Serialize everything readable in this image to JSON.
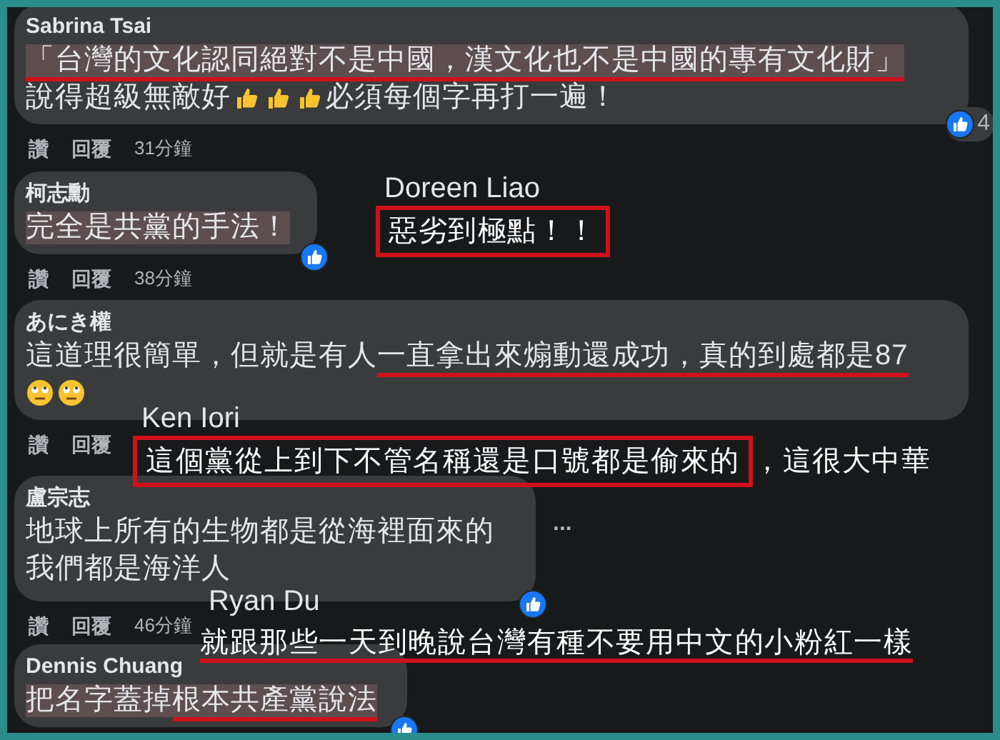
{
  "comments": [
    {
      "author": "Sabrina Tsai",
      "lines": [
        [
          {
            "kind": "text",
            "text": "「台灣的文化認同絕對不是中國，漢文化也不是中國的專有文化財」",
            "highlighted": true,
            "underlined": true
          }
        ],
        [
          {
            "kind": "text",
            "text": "說得超級無敵好",
            "highlighted": false,
            "underlined": false
          },
          {
            "kind": "thumbs"
          },
          {
            "kind": "thumbs"
          },
          {
            "kind": "thumbs"
          },
          {
            "kind": "text",
            "text": "必須每個字再打一遍！",
            "highlighted": false,
            "underlined": false
          }
        ]
      ],
      "has_reaction": true,
      "reaction_count": "4",
      "actions": [
        "讚",
        "回覆"
      ],
      "time": "31分鐘"
    },
    {
      "author": "柯志勳",
      "lines": [
        [
          {
            "kind": "text",
            "text": "完全是共黨的手法！",
            "highlighted": true,
            "underlined": false
          }
        ]
      ],
      "has_reaction": true,
      "actions": [
        "讚",
        "回覆"
      ],
      "time": "38分鐘"
    },
    {
      "author": "あにき權",
      "lines": [
        [
          {
            "kind": "text",
            "text": "這道理很簡單，但就是有人",
            "highlighted": false,
            "underlined": false
          },
          {
            "kind": "text",
            "text": "一直拿出來煽動還成功，真的到處都是87",
            "highlighted": false,
            "underlined": true
          }
        ],
        [
          {
            "kind": "eyeroll"
          },
          {
            "kind": "eyeroll"
          }
        ]
      ],
      "has_reaction": false,
      "actions": [
        "讚",
        "回覆"
      ]
    },
    {
      "author": "盧宗志",
      "lines": [
        [
          {
            "kind": "text",
            "text": "地球上所有的生物都是從海裡面來的",
            "highlighted": false,
            "underlined": false
          }
        ],
        [
          {
            "kind": "text",
            "text": "我們都是海洋人",
            "highlighted": false,
            "underlined": false
          }
        ]
      ],
      "has_reaction": true,
      "more": "...",
      "actions": [
        "讚",
        "回覆"
      ],
      "time": "46分鐘"
    },
    {
      "author": "Dennis Chuang",
      "lines": [
        [
          {
            "kind": "text",
            "text": "把名字蓋掉",
            "highlighted": true,
            "underlined": false
          },
          {
            "kind": "text",
            "text": "根本共產黨說法",
            "highlighted": true,
            "underlined": true
          }
        ]
      ],
      "has_reaction": true
    }
  ],
  "annotations": [
    {
      "author": "Doreen Liao",
      "segments": [
        {
          "text": "惡劣到極點！！",
          "boxed": true,
          "underlined": false
        }
      ]
    },
    {
      "author": "Ken Iori",
      "segments": [
        {
          "text": "這個黨從上到下不管名稱還是口號都是偷來的",
          "boxed": true,
          "underlined": false
        },
        {
          "text": "，這很大中華",
          "boxed": false,
          "underlined": false
        }
      ]
    },
    {
      "author": "Ryan Du",
      "segments": [
        {
          "text": "就跟那些一天到晚說台灣有種不要用中文的小粉紅一樣",
          "boxed": false,
          "underlined": true
        }
      ]
    }
  ]
}
